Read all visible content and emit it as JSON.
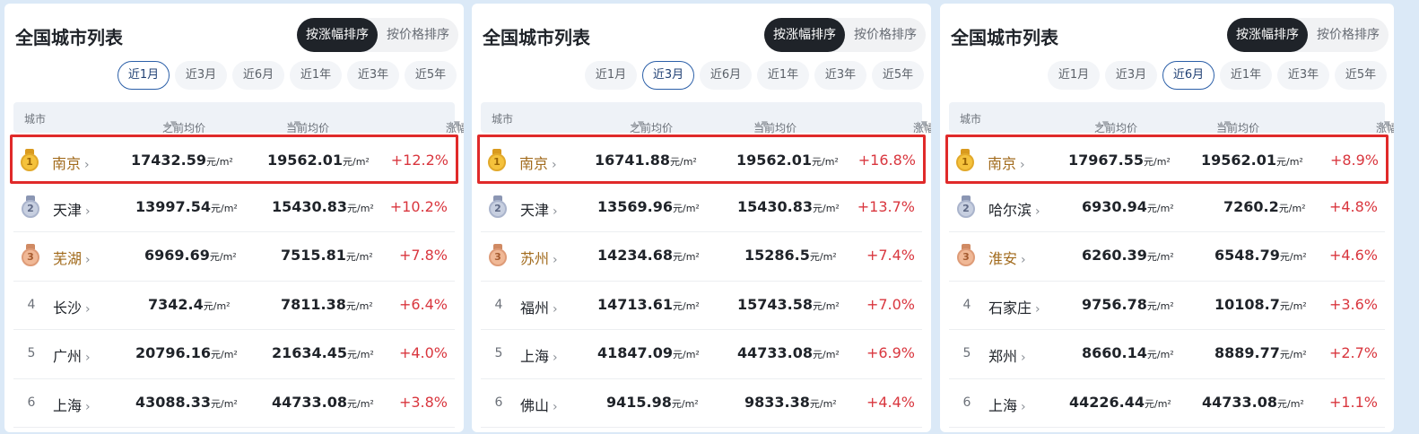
{
  "panels": [
    {
      "title": "全国城市列表",
      "sort_options": [
        "按涨幅排序",
        "按价格排序"
      ],
      "sort_active": 0,
      "periods": [
        "近1月",
        "近3月",
        "近6月",
        "近1年",
        "近3年",
        "近5年"
      ],
      "period_active": 0,
      "columns": {
        "city": "城市",
        "before": "之前均价",
        "current": "当前均价",
        "change": "涨幅"
      },
      "rows": [
        {
          "rank": "1",
          "city": "南京",
          "before": "17432.59",
          "current": "19562.01",
          "change": "+12.2%"
        },
        {
          "rank": "2",
          "city": "天津",
          "before": "13997.54",
          "current": "15430.83",
          "change": "+10.2%"
        },
        {
          "rank": "3",
          "city": "芜湖",
          "before": "6969.69",
          "current": "7515.81",
          "change": "+7.8%"
        },
        {
          "rank": "4",
          "city": "长沙",
          "before": "7342.4",
          "current": "7811.38",
          "change": "+6.4%"
        },
        {
          "rank": "5",
          "city": "广州",
          "before": "20796.16",
          "current": "21634.45",
          "change": "+4.0%"
        },
        {
          "rank": "6",
          "city": "上海",
          "before": "43088.33",
          "current": "44733.08",
          "change": "+3.8%"
        }
      ]
    },
    {
      "title": "全国城市列表",
      "sort_options": [
        "按涨幅排序",
        "按价格排序"
      ],
      "sort_active": 0,
      "periods": [
        "近1月",
        "近3月",
        "近6月",
        "近1年",
        "近3年",
        "近5年"
      ],
      "period_active": 1,
      "columns": {
        "city": "城市",
        "before": "之前均价",
        "current": "当前均价",
        "change": "涨幅"
      },
      "rows": [
        {
          "rank": "1",
          "city": "南京",
          "before": "16741.88",
          "current": "19562.01",
          "change": "+16.8%"
        },
        {
          "rank": "2",
          "city": "天津",
          "before": "13569.96",
          "current": "15430.83",
          "change": "+13.7%"
        },
        {
          "rank": "3",
          "city": "苏州",
          "before": "14234.68",
          "current": "15286.5",
          "change": "+7.4%"
        },
        {
          "rank": "4",
          "city": "福州",
          "before": "14713.61",
          "current": "15743.58",
          "change": "+7.0%"
        },
        {
          "rank": "5",
          "city": "上海",
          "before": "41847.09",
          "current": "44733.08",
          "change": "+6.9%"
        },
        {
          "rank": "6",
          "city": "佛山",
          "before": "9415.98",
          "current": "9833.38",
          "change": "+4.4%"
        }
      ]
    },
    {
      "title": "全国城市列表",
      "sort_options": [
        "按涨幅排序",
        "按价格排序"
      ],
      "sort_active": 0,
      "periods": [
        "近1月",
        "近3月",
        "近6月",
        "近1年",
        "近3年",
        "近5年"
      ],
      "period_active": 2,
      "columns": {
        "city": "城市",
        "before": "之前均价",
        "current": "当前均价",
        "change": "涨幅"
      },
      "rows": [
        {
          "rank": "1",
          "city": "南京",
          "before": "17967.55",
          "current": "19562.01",
          "change": "+8.9%"
        },
        {
          "rank": "2",
          "city": "哈尔滨",
          "before": "6930.94",
          "current": "7260.2",
          "change": "+4.8%"
        },
        {
          "rank": "3",
          "city": "淮安",
          "before": "6260.39",
          "current": "6548.79",
          "change": "+4.6%"
        },
        {
          "rank": "4",
          "city": "石家庄",
          "before": "9756.78",
          "current": "10108.7",
          "change": "+3.6%"
        },
        {
          "rank": "5",
          "city": "郑州",
          "before": "8660.14",
          "current": "8889.77",
          "change": "+2.7%"
        },
        {
          "rank": "6",
          "city": "上海",
          "before": "44226.44",
          "current": "44733.08",
          "change": "+1.1%"
        }
      ]
    }
  ],
  "unit": "元/m²",
  "colors": {
    "highlight": "#e02a2a",
    "change_up": "#d9363e",
    "active_sort_bg": "#1f2329"
  }
}
